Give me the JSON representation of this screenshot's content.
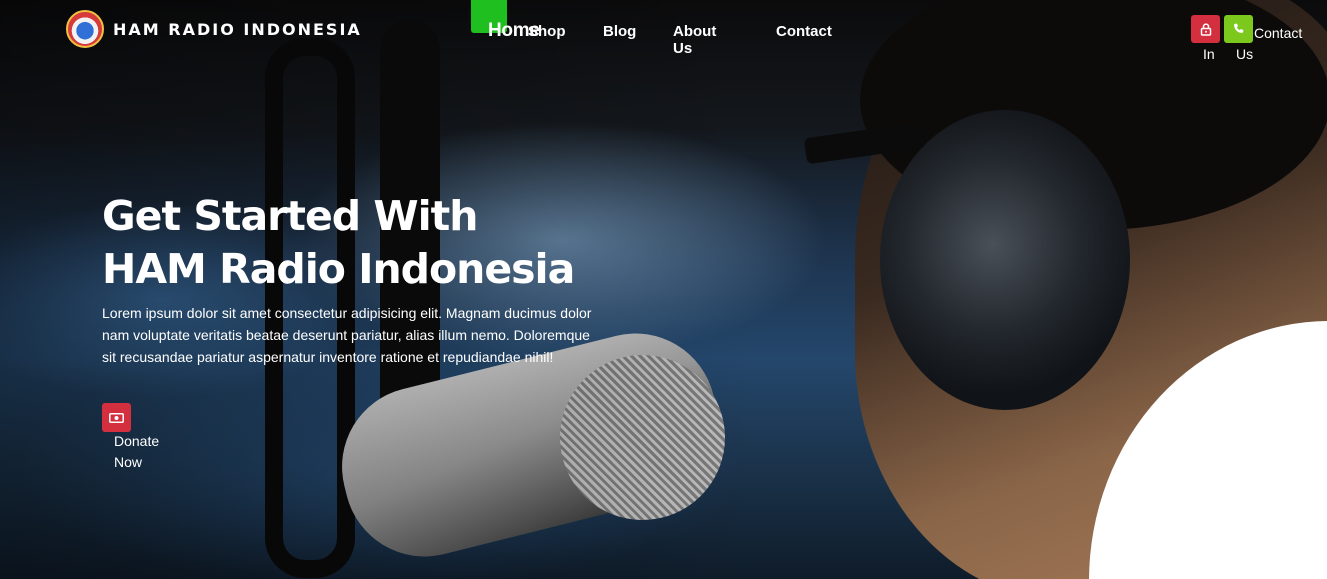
{
  "header": {
    "brand": "HAM RADIO INDONESIA",
    "logo_icon": "ham-radio-logo"
  },
  "nav": {
    "items": [
      {
        "label": "Home",
        "active": true
      },
      {
        "label": "Shop"
      },
      {
        "label": "Blog"
      },
      {
        "label": "About Us"
      },
      {
        "label": "Contact"
      }
    ],
    "active_indicator_color": "#1fbf1f"
  },
  "header_actions": {
    "login": {
      "label": "In",
      "icon": "lock-icon",
      "color": "#d32f3f"
    },
    "contact": {
      "label_line1": "Contact",
      "label_line2": "Us",
      "icon": "phone-icon",
      "color": "#7cc81d"
    }
  },
  "hero": {
    "title_line1": "Get Started With",
    "title_line2": "HAM Radio Indonesia",
    "body": "Lorem ipsum dolor sit amet consectetur adipisicing elit. Magnam ducimus dolor nam voluptate veritatis beatae deserunt pariatur, alias illum nemo. Doloremque sit recusandae pariatur aspernatur inventore ratione et repudiandae nihil!",
    "donate": {
      "label_line1": "Donate",
      "label_line2": "Now",
      "icon": "money-icon",
      "color": "#d32f3f"
    }
  }
}
